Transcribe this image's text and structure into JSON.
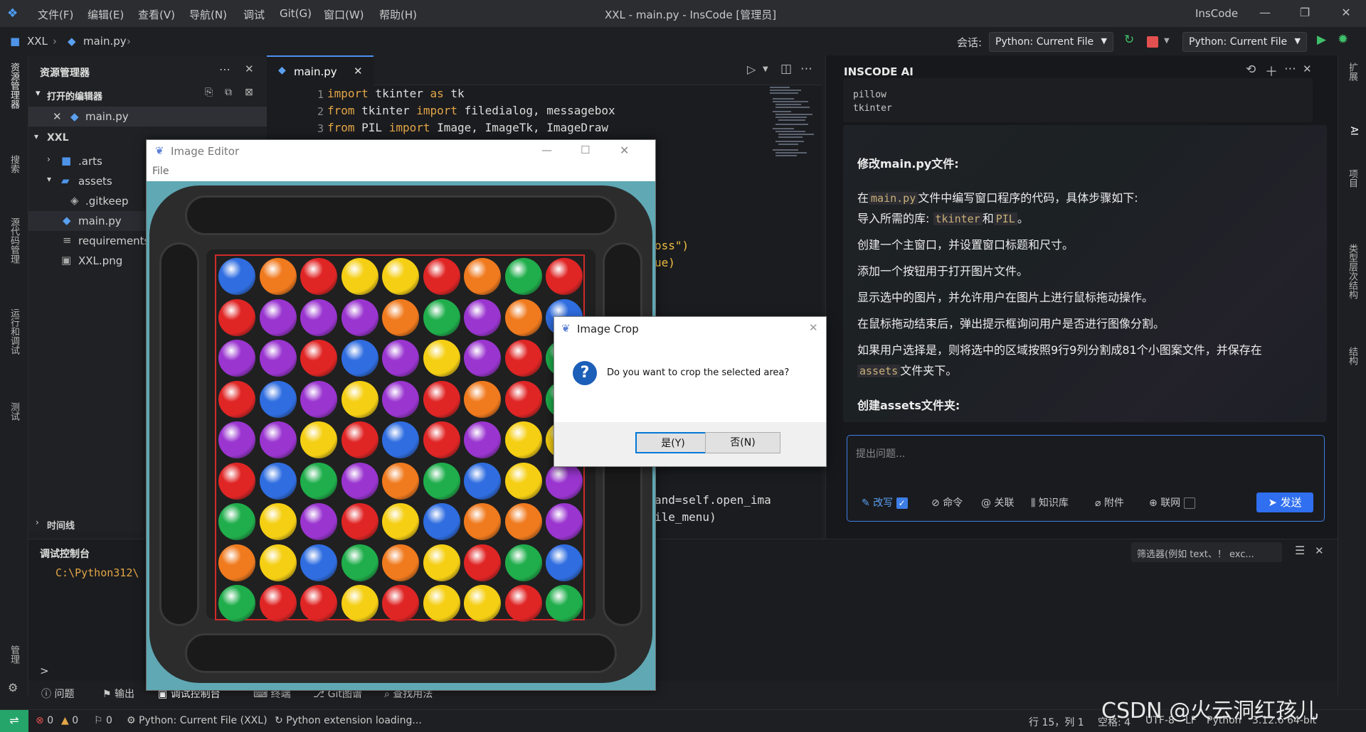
{
  "titlebar": {
    "menus": [
      "文件(F)",
      "编辑(E)",
      "查看(V)",
      "导航(N)",
      "调试",
      "Git(G)",
      "窗口(W)",
      "帮助(H)"
    ],
    "window_title": "XXL - main.py - InsCode [管理员]",
    "brand": "InsCode"
  },
  "toolbar": {
    "breadcrumb": [
      "XXL",
      "main.py"
    ],
    "session_label": "会话:",
    "session_value": "Python: Current File",
    "run_config": "Python: Current File"
  },
  "activity_left": [
    "资源管理器",
    "搜索",
    "源代码管理",
    "运行和调试",
    "测试",
    "管理"
  ],
  "activity_right": [
    "扩展",
    "AI",
    "项目",
    "类型层次结构",
    "结构"
  ],
  "sidebar": {
    "title": "资源管理器",
    "open_editors": "打开的编辑器",
    "open_file": "main.py",
    "project": "XXL",
    "items": [
      ".arts",
      "assets",
      ".gitkeep",
      "main.py",
      "requirements.txt",
      "XXL.png"
    ],
    "timeline": "时间线",
    "debug_console": "调试控制台"
  },
  "editor": {
    "tab": "main.py",
    "lines": [
      {
        "no": "1",
        "kw1": "import",
        "rest": " tkinter ",
        "kw2": "as",
        "tail": " tk"
      },
      {
        "no": "2",
        "kw1": "from",
        "rest": " tkinter ",
        "kw2": "import",
        "tail": " filedialog, messagebox"
      },
      {
        "no": "3",
        "kw1": "from",
        "rest": " PIL ",
        "kw2": "import",
        "tail": " Image, ImageTk, ImageDraw"
      }
    ],
    "frag1": "oss\")",
    "frag2": "ue)",
    "frag3": "and=self.open_ima",
    "frag4": "ile_menu)"
  },
  "ai": {
    "title": "INSCODE AI",
    "code_lines": [
      "pillow",
      "tkinter"
    ],
    "heading1": "修改main.py文件:",
    "p1_a": "在",
    "p1_code": "main.py",
    "p1_b": "文件中编写窗口程序的代码，具体步骤如下:",
    "p2_a": "导入所需的库:",
    "p2_code1": "tkinter",
    "p2_mid": "和",
    "p2_code2": "PIL",
    "p2_end": "。",
    "p3": "创建一个主窗口，并设置窗口标题和尺寸。",
    "p4": "添加一个按钮用于打开图片文件。",
    "p5": "显示选中的图片，并允许用户在图片上进行鼠标拖动操作。",
    "p6": "在鼠标拖动结束后，弹出提示框询问用户是否进行图像分割。",
    "p7": "如果用户选择是，则将选中的区域按照9行9列分割成81个小图案文件，并保存在",
    "p7_code": "assets",
    "p7_end": "文件夹下。",
    "heading2": "创建assets文件夹:",
    "input_placeholder": "提出问题...",
    "options": [
      "改写",
      "命令",
      "关联",
      "知识库",
      "附件",
      "联网"
    ],
    "send": "发送"
  },
  "debug": {
    "path": "C:\\Python312\\",
    "filter_placeholder": "筛选器(例如 text、！ exc...",
    "prompt": ">"
  },
  "bottom_tabs": [
    "问题",
    "输出",
    "调试控制台",
    "终端",
    "Git图谱",
    "查找用法"
  ],
  "status": {
    "errors": "0",
    "warnings": "0",
    "ports": "0",
    "interpreter": "Python: Current File (XXL)",
    "loading": "Python extension loading...",
    "position": "行 15，列 1",
    "spaces": "空格: 4",
    "encoding": "UTF-8",
    "eol": "LF",
    "language": "Python",
    "version": "3.12.6 64-bit",
    "watermark": "CSDN @火云洞红孩儿"
  },
  "tk_window": {
    "title": "Image Editor",
    "menu": "File",
    "ball_colors": {
      "blue": "#2f6de0",
      "orange": "#f07a1e",
      "red": "#e02525",
      "yellow": "#f5cf14",
      "green": "#1fae4b",
      "purple": "#9a35d0"
    },
    "grid": [
      [
        "blue",
        "orange",
        "red",
        "yellow",
        "yellow",
        "red",
        "orange",
        "green",
        "red"
      ],
      [
        "red",
        "purple",
        "purple",
        "purple",
        "orange",
        "green",
        "purple",
        "orange",
        "blue"
      ],
      [
        "purple",
        "purple",
        "red",
        "blue",
        "purple",
        "yellow",
        "purple",
        "red",
        "green"
      ],
      [
        "red",
        "blue",
        "purple",
        "yellow",
        "purple",
        "red",
        "orange",
        "red",
        "green"
      ],
      [
        "purple",
        "purple",
        "yellow",
        "red",
        "blue",
        "red",
        "purple",
        "yellow",
        "yellow"
      ],
      [
        "red",
        "blue",
        "green",
        "purple",
        "orange",
        "green",
        "blue",
        "yellow",
        "purple"
      ],
      [
        "green",
        "yellow",
        "purple",
        "red",
        "yellow",
        "blue",
        "orange",
        "orange",
        "purple"
      ],
      [
        "orange",
        "yellow",
        "blue",
        "green",
        "orange",
        "yellow",
        "red",
        "green",
        "blue"
      ],
      [
        "green",
        "red",
        "red",
        "yellow",
        "red",
        "yellow",
        "yellow",
        "red",
        "green"
      ]
    ]
  },
  "dialog": {
    "title": "Image Crop",
    "message": "Do you want to crop the selected area?",
    "yes": "是(Y)",
    "no": "否(N)"
  }
}
